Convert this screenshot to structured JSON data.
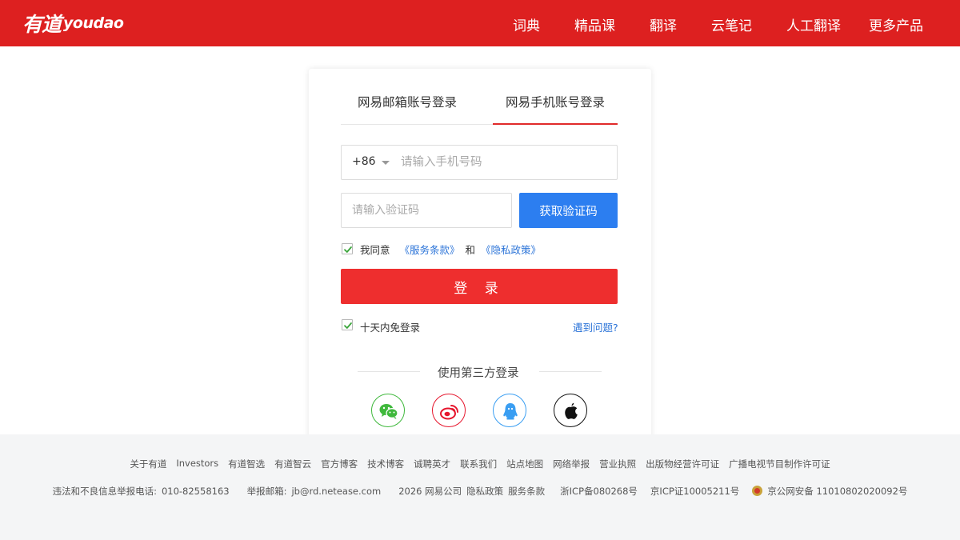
{
  "header": {
    "logo_cn": "有道",
    "logo_en": "youdao",
    "nav": [
      {
        "label": "词典"
      },
      {
        "label": "精品课"
      },
      {
        "label": "翻译"
      },
      {
        "label": "云笔记"
      },
      {
        "label": "人工翻译"
      },
      {
        "label": "更多产品"
      }
    ]
  },
  "login": {
    "tabs": [
      {
        "label": "网易邮箱账号登录",
        "active": false
      },
      {
        "label": "网易手机账号登录",
        "active": true
      }
    ],
    "country_code": "+86",
    "phone_value": "",
    "phone_placeholder": "请输入手机号码",
    "code_value": "",
    "code_placeholder": "请输入验证码",
    "get_code_label": "获取验证码",
    "agree": {
      "checked": true,
      "prefix": "我同意",
      "terms_link": "《服务条款》",
      "and": "和",
      "privacy_link": "《隐私政策》"
    },
    "submit_label": "登 录",
    "remember": {
      "checked": true,
      "label": "十天内免登录"
    },
    "problem_link": "遇到问题?",
    "third_party": {
      "title": "使用第三方登录",
      "providers": [
        {
          "name": "wechat-icon",
          "color": "#3fb83c"
        },
        {
          "name": "weibo-icon",
          "color": "#e6162d"
        },
        {
          "name": "qq-icon",
          "color": "#3a9ef2"
        },
        {
          "name": "apple-icon",
          "color": "#111111"
        }
      ]
    }
  },
  "colors": {
    "header_bg": "#dd2020",
    "primary_red": "#ee2e2e",
    "primary_blue": "#2c7ef0",
    "link_blue": "#2c74d8",
    "footer_bg": "#f4f5f6"
  },
  "footer": {
    "links": [
      "关于有道",
      "Investors",
      "有道智选",
      "有道智云",
      "官方博客",
      "技术博客",
      "诚聘英才",
      "联系我们",
      "站点地图",
      "网络举报",
      "营业执照",
      "出版物经营许可证",
      "广播电视节目制作许可证"
    ],
    "report_phone_label": "违法和不良信息举报电话:",
    "report_phone": "010-82558163",
    "report_email_label": "举报邮箱:",
    "report_email": "jb@rd.netease.com",
    "copyright": "2026 网易公司",
    "privacy": "隐私政策",
    "terms": "服务条款",
    "icp1": "浙ICP备080268号",
    "icp2": "京ICP证10005211号",
    "police": "京公网安备 11010802020092号"
  }
}
